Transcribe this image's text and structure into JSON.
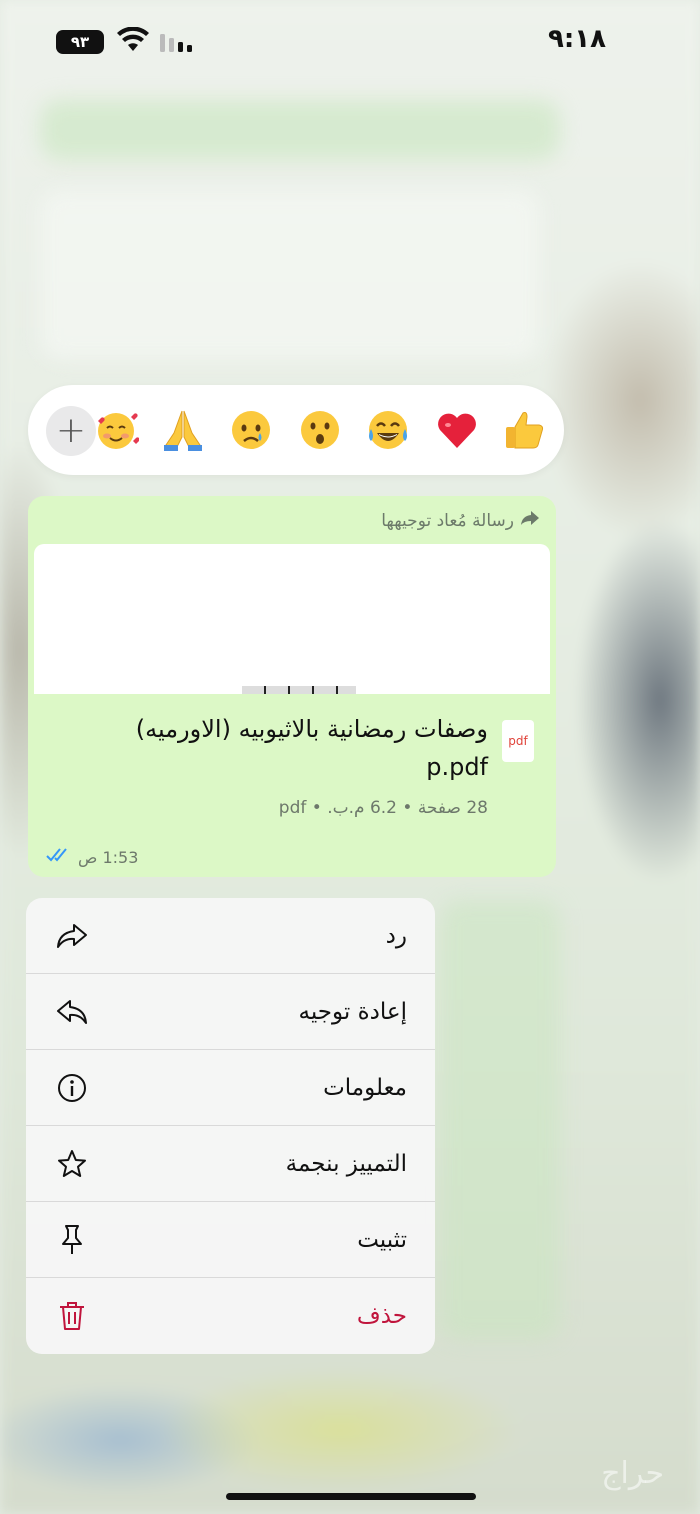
{
  "status_bar": {
    "time": "٩:١٨",
    "battery": "٩٣"
  },
  "reactions": {
    "emojis": [
      {
        "name": "thumbs-up",
        "label": "thumbs up"
      },
      {
        "name": "red-heart",
        "label": "heart"
      },
      {
        "name": "tears-of-joy",
        "label": "laughing"
      },
      {
        "name": "surprised",
        "label": "surprised"
      },
      {
        "name": "crying",
        "label": "sad"
      },
      {
        "name": "folded-hands",
        "label": "pray"
      },
      {
        "name": "smiling-hearts",
        "label": "love"
      }
    ],
    "more_icon": "plus-icon"
  },
  "message": {
    "forwarded_label": "رسالة مُعاد توجيهها",
    "file_type_icon": "pdf",
    "file_name": "وصفات رمضانية بالاثيوبيه (الاورميه) p.pdf",
    "file_meta": "28 صفحة • 6.2 م.ب. • pdf",
    "time": "1:53 ص",
    "status": "read"
  },
  "menu": {
    "items": [
      {
        "label": "رد",
        "icon": "reply-icon",
        "danger": false
      },
      {
        "label": "إعادة توجيه",
        "icon": "forward-icon",
        "danger": false
      },
      {
        "label": "معلومات",
        "icon": "info-icon",
        "danger": false
      },
      {
        "label": "التمييز بنجمة",
        "icon": "star-icon",
        "danger": false
      },
      {
        "label": "تثبيت",
        "icon": "pin-icon",
        "danger": false
      },
      {
        "label": "حذف",
        "icon": "trash-icon",
        "danger": true
      }
    ]
  },
  "watermark": "حراج",
  "colors": {
    "bubble": "#dcf8c6",
    "danger": "#c0143c",
    "read_tick": "#3497f9"
  }
}
